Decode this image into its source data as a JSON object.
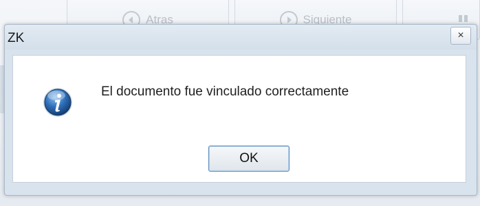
{
  "background": {
    "back_label": "Atras",
    "next_label": "Siguiente"
  },
  "dialog": {
    "title": "ZK",
    "close_symbol": "×",
    "icon": "info-icon",
    "message": "El documento fue vinculado correctamente",
    "ok_label": "OK"
  },
  "colors": {
    "titlebar": "#d9e3ed",
    "content_bg": "#ffffff",
    "ok_border": "#5a8bbd",
    "info_icon_blue": "#2e6fb8"
  }
}
